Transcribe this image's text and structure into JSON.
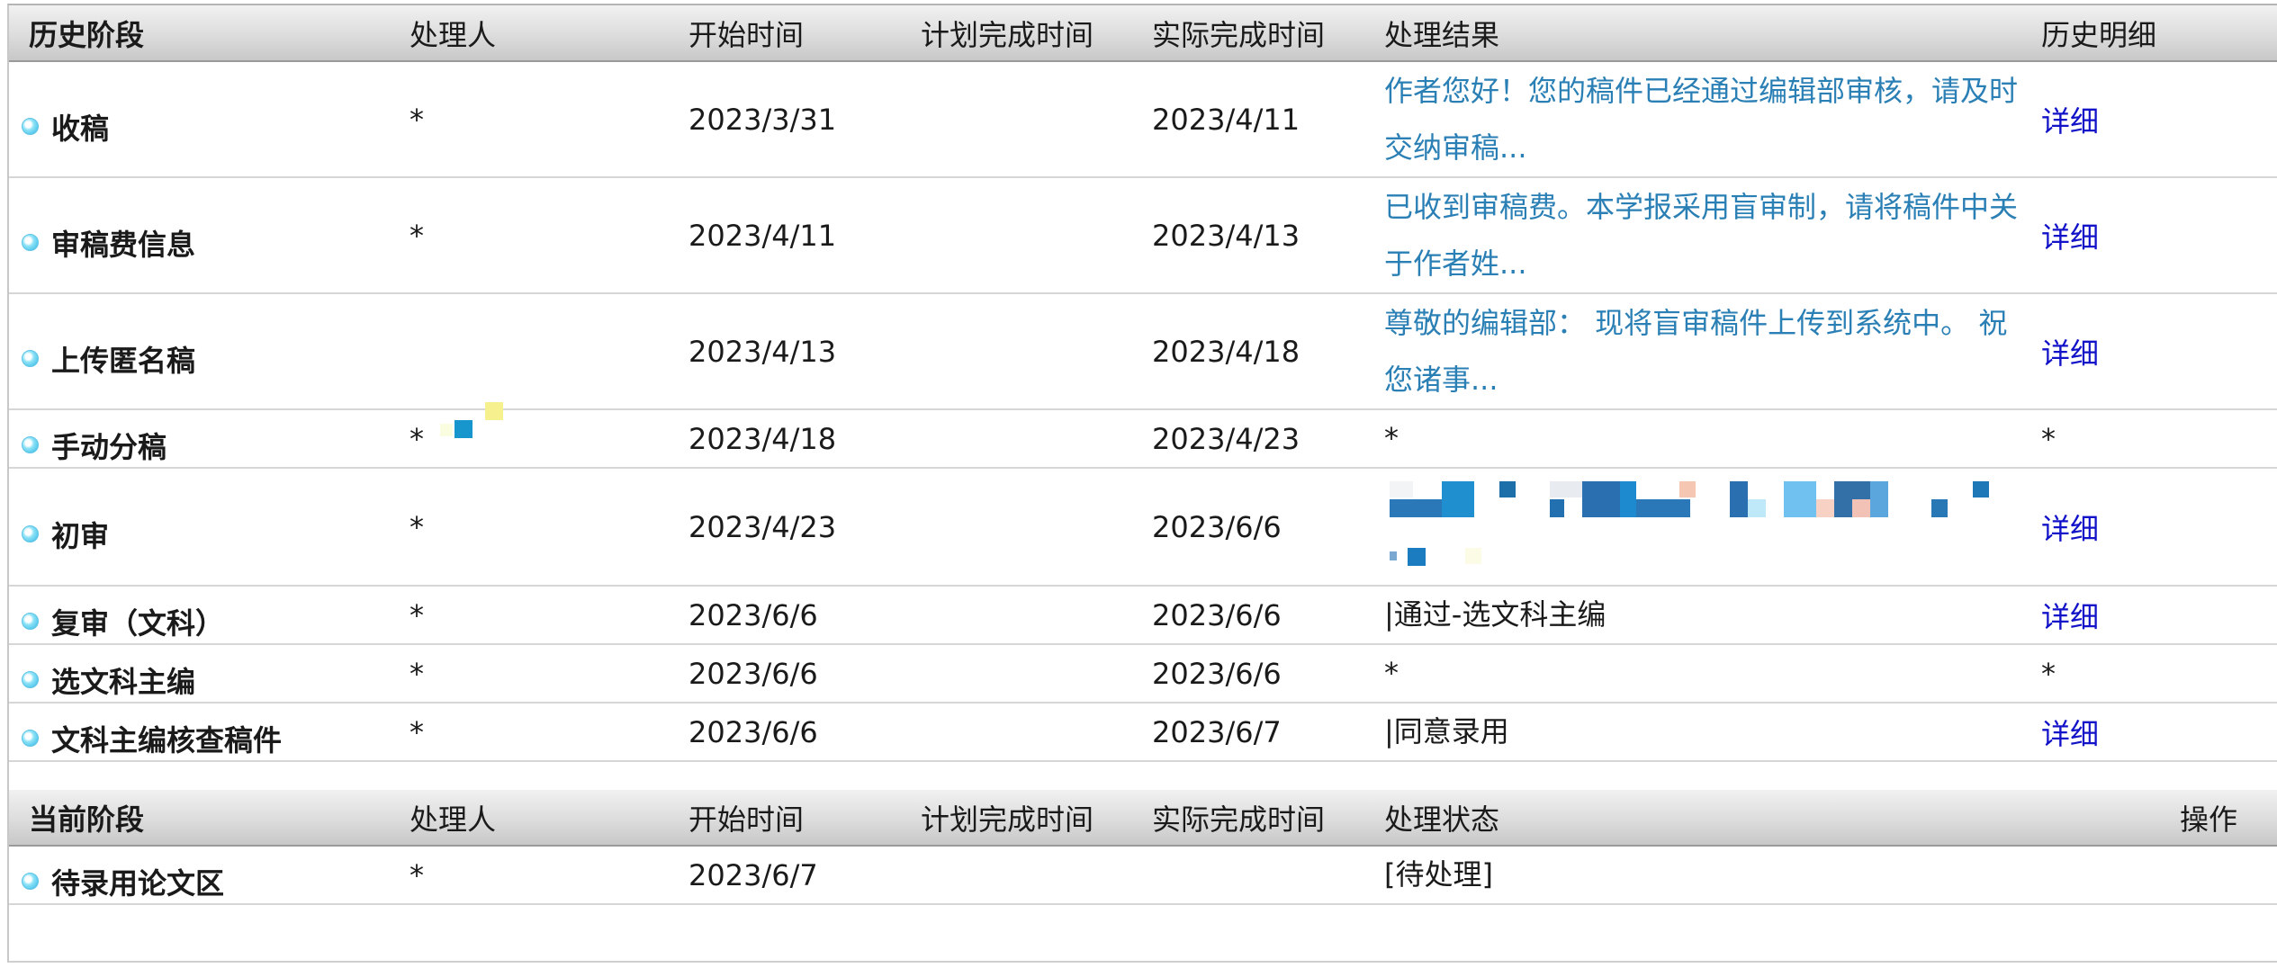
{
  "history": {
    "headers": {
      "stage": "历史阶段",
      "handler": "处理人",
      "start": "开始时间",
      "planned": "计划完成时间",
      "actual": "实际完成时间",
      "result": "处理结果",
      "detail": "历史明细"
    },
    "rows": [
      {
        "stage": "收稿",
        "handler": "*",
        "start": "2023/3/31",
        "planned": "",
        "actual": "2023/4/11",
        "result_line1": "作者您好！您的稿件已经通过编辑部审核，请及时",
        "result_line2": "交纳审稿...",
        "detail": "详细"
      },
      {
        "stage": "审稿费信息",
        "handler": "*",
        "start": "2023/4/11",
        "planned": "",
        "actual": "2023/4/13",
        "result_line1": "已收到审稿费。本学报采用盲审制，请将稿件中关",
        "result_line2": "于作者姓...",
        "detail": "详细"
      },
      {
        "stage": "上传匿名稿",
        "handler": "",
        "start": "2023/4/13",
        "planned": "",
        "actual": "2023/4/18",
        "result_line1": "尊敬的编辑部：  现将盲审稿件上传到系统中。  祝",
        "result_line2": "您诸事...",
        "detail": "详细"
      },
      {
        "stage": "手动分稿",
        "handler": "*",
        "start": "2023/4/18",
        "planned": "",
        "actual": "2023/4/23",
        "result": "*",
        "detail": "*"
      },
      {
        "stage": "初审",
        "handler": "*",
        "start": "2023/4/23",
        "planned": "",
        "actual": "2023/6/6",
        "result": "",
        "detail": "详细"
      },
      {
        "stage": "复审（文科）",
        "handler": "*",
        "start": "2023/6/6",
        "planned": "",
        "actual": "2023/6/6",
        "result": "|通过-选文科主编",
        "detail": "详细"
      },
      {
        "stage": "选文科主编",
        "handler": "*",
        "start": "2023/6/6",
        "planned": "",
        "actual": "2023/6/6",
        "result": "*",
        "detail": "*"
      },
      {
        "stage": "文科主编核查稿件",
        "handler": "*",
        "start": "2023/6/6",
        "planned": "",
        "actual": "2023/6/7",
        "result": "|同意录用",
        "detail": "详细"
      }
    ]
  },
  "current": {
    "headers": {
      "stage": "当前阶段",
      "handler": "处理人",
      "start": "开始时间",
      "planned": "计划完成时间",
      "actual": "实际完成时间",
      "status": "处理状态",
      "action": "操作"
    },
    "rows": [
      {
        "stage": "待录用论文区",
        "handler": "*",
        "start": "2023/6/7",
        "planned": "",
        "actual": "",
        "status": "[待处理]",
        "action": ""
      }
    ]
  },
  "colors": {
    "result_link": "#2a7fb5",
    "detail_link": "#1212c8",
    "header_gradient_top": "#f1f1f1",
    "header_gradient_bottom": "#c7c7c7",
    "bullet": "#2fb6e4"
  }
}
